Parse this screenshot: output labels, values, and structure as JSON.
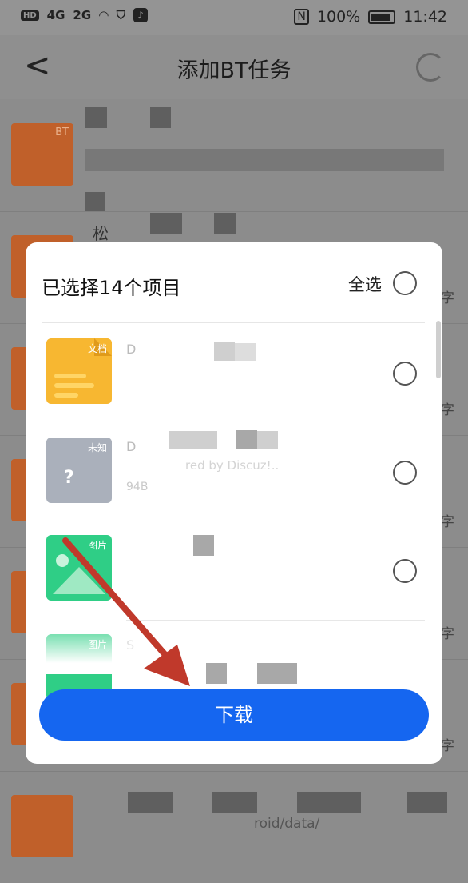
{
  "status_bar": {
    "left_items": [
      "HD",
      "4G",
      "2G"
    ],
    "right_text": "100%",
    "time": "11:42",
    "nfc_label": "N"
  },
  "header": {
    "back_glyph": "<",
    "title": "添加BT任务"
  },
  "background_list": {
    "thumb_tag": "BT",
    "visible_fragments": [
      "松",
      "字",
      "字",
      "字",
      "字",
      "字",
      "roid/data/"
    ]
  },
  "dialog": {
    "title": "已选择14个项目",
    "select_all_label": "全选",
    "files": [
      {
        "type_tag": "文档",
        "name": "D",
        "size": ""
      },
      {
        "type_tag": "未知",
        "name": "D",
        "size": "94B",
        "watermark": "red by Discuz!.."
      },
      {
        "type_tag": "图片",
        "name": "",
        "size": ""
      },
      {
        "type_tag": "图片",
        "name": "S",
        "size": ""
      }
    ],
    "download_label": "下载"
  },
  "colors": {
    "accent": "#1566f0",
    "overlay": "#8c8c8c",
    "doc_icon": "#f7b731",
    "unknown_icon": "#aab0bb",
    "image_icon": "#2fce86",
    "annotation_arrow": "#c0392b"
  }
}
